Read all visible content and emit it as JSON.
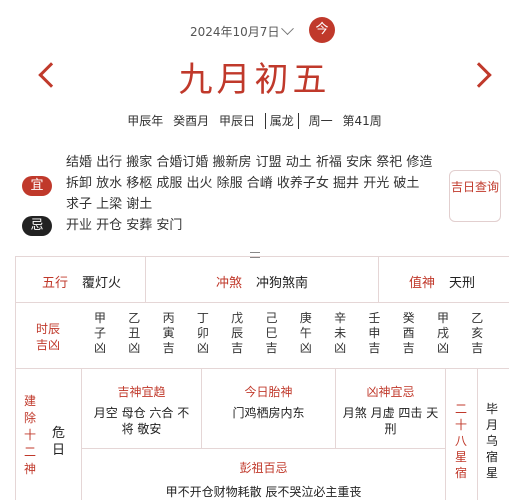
{
  "header": {
    "date_selector": "2024年10月7日",
    "today_button": "今",
    "lunar_title": "九月初五",
    "ganzhi": {
      "year": "甲辰年",
      "month": "癸酉月",
      "day": "甲辰日",
      "zodiac": "属龙",
      "weekday": "周一",
      "week": "第41周"
    }
  },
  "yi": {
    "badge": "宜",
    "text": "结婚 出行 搬家 合婚订婚 搬新房 订盟 动土 祈福 安床 祭祀 修造 拆卸 放水 移柩 成服 出火 除服 合嵴 收养子女 掘井 开光 破土 求子 上梁 谢土"
  },
  "ji": {
    "badge": "忌",
    "text": "开业 开仓 安葬 安门"
  },
  "query_button": "吉日查询",
  "row1": {
    "wuxing_label": "五行",
    "wuxing_value": "覆灯火",
    "chongsha_label": "冲煞",
    "chongsha_value": "冲狗煞南",
    "zhishen_label": "值神",
    "zhishen_value": "天刑"
  },
  "hours": {
    "label": "时辰吉凶",
    "items": [
      {
        "gz": "甲子",
        "luck": "凶"
      },
      {
        "gz": "乙丑",
        "luck": "凶"
      },
      {
        "gz": "丙寅",
        "luck": "吉"
      },
      {
        "gz": "丁卯",
        "luck": "凶"
      },
      {
        "gz": "戊辰",
        "luck": "吉"
      },
      {
        "gz": "己巳",
        "luck": "吉"
      },
      {
        "gz": "庚午",
        "luck": "凶"
      },
      {
        "gz": "辛未",
        "luck": "凶"
      },
      {
        "gz": "壬申",
        "luck": "吉"
      },
      {
        "gz": "癸酉",
        "luck": "吉"
      },
      {
        "gz": "甲戌",
        "luck": "凶"
      },
      {
        "gz": "乙亥",
        "luck": "吉"
      }
    ]
  },
  "jianchu": {
    "label": "建除十二神",
    "value": "危日"
  },
  "jishen": {
    "title": "吉神宜趋",
    "body": "月空 母仓 六合 不将 敬安"
  },
  "taishen": {
    "title": "今日胎神",
    "body": "门鸡栖房内东"
  },
  "xiongshen": {
    "title": "凶神宜忌",
    "body": "月煞 月虚 四击 天刑"
  },
  "xiu": {
    "label": "二十八星宿",
    "value": "毕月乌宿星"
  },
  "pengzu": {
    "title": "彭祖百忌",
    "text": "甲不开仓财物耗散 辰不哭泣必主重丧"
  }
}
